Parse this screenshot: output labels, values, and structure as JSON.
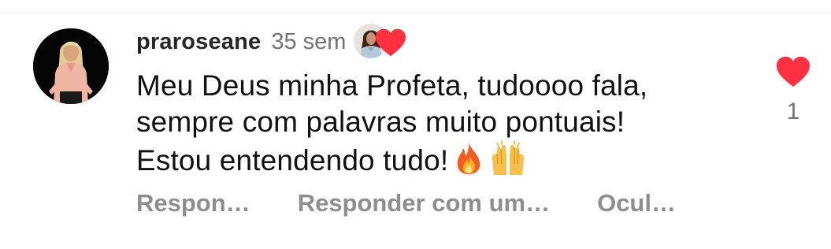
{
  "comment": {
    "username": "praroseane",
    "timestamp": "35 sem",
    "text_lines": [
      "Meu Deus minha Profeta, tudoooo fala,",
      "sempre com palavras muito pontuais!",
      "Estou entendendo tudo!"
    ],
    "emojis": [
      "fire-emoji",
      "raising-hands-emoji"
    ],
    "creator_liked": true
  },
  "actions": {
    "reply": "Respon…",
    "reply_with": "Responder com um…",
    "hide": "Ocul…"
  },
  "like": {
    "count": "1",
    "liked": true,
    "heart_color": "#ff3040"
  },
  "icons": {
    "like": "heart-icon",
    "creator_like": "heart-icon"
  },
  "colors": {
    "username": "#262626",
    "secondary_text": "#737373",
    "action_text": "#8e8e8e",
    "heart": "#ff3040"
  }
}
